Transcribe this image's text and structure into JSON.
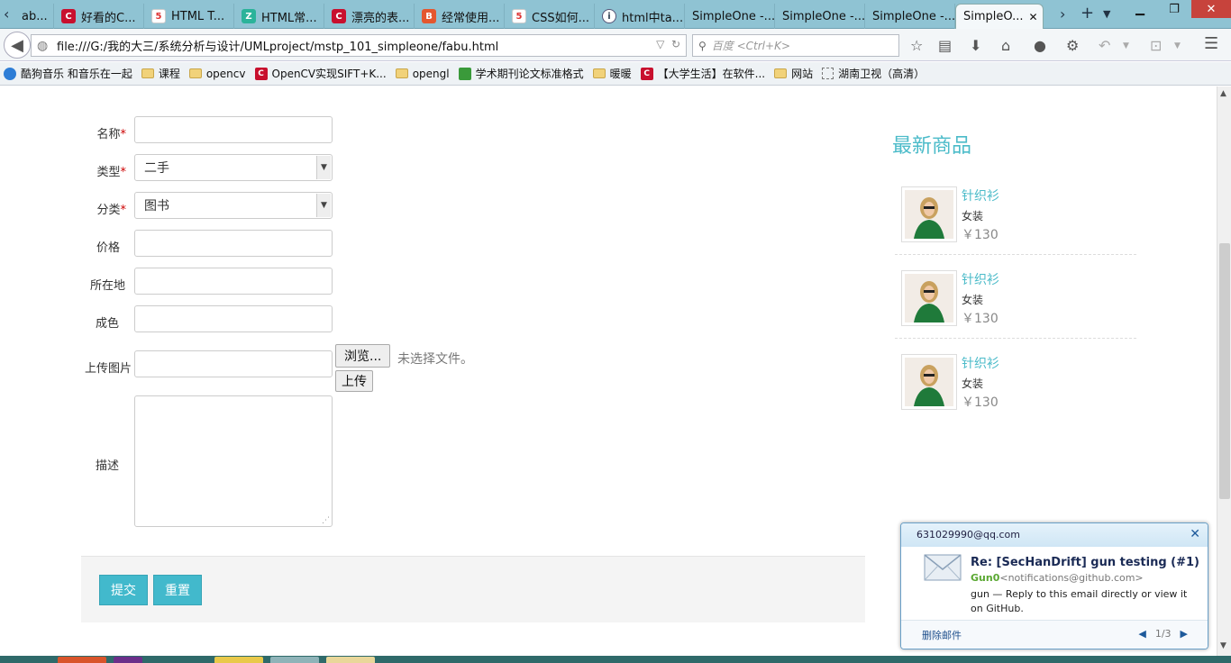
{
  "tabs": [
    {
      "label": "ab...",
      "icon": "none"
    },
    {
      "label": "好看的C...",
      "icon": "c"
    },
    {
      "label": "HTML T...",
      "icon": "h5"
    },
    {
      "label": "HTML常...",
      "icon": "z"
    },
    {
      "label": "漂亮的表...",
      "icon": "c"
    },
    {
      "label": "经常使用...",
      "icon": "b"
    },
    {
      "label": "CSS如何...",
      "icon": "h5"
    },
    {
      "label": "html中ta...",
      "icon": "i"
    },
    {
      "label": "SimpleOne -...",
      "icon": "none"
    },
    {
      "label": "SimpleOne -...",
      "icon": "none"
    },
    {
      "label": "SimpleOne -...",
      "icon": "none"
    },
    {
      "label": "SimpleO...",
      "icon": "none"
    }
  ],
  "toolbar": {
    "url": "file:///G:/我的大三/系统分析与设计/UMLproject/mstp_101_simpleone/fabu.html",
    "search_placeholder": "百度 <Ctrl+K>"
  },
  "bookmarks": [
    {
      "label": "酷狗音乐 和音乐在一起",
      "icon": "kugou"
    },
    {
      "label": "课程",
      "icon": "folder"
    },
    {
      "label": "opencv",
      "icon": "folder"
    },
    {
      "label": "OpenCV实现SIFT+K...",
      "icon": "csdn"
    },
    {
      "label": "opengl",
      "icon": "folder"
    },
    {
      "label": "学术期刊论文标准格式",
      "icon": "green"
    },
    {
      "label": "暖暖",
      "icon": "folder"
    },
    {
      "label": "【大学生活】在软件...",
      "icon": "csdn"
    },
    {
      "label": "网站",
      "icon": "folder"
    },
    {
      "label": "湖南卫视（高清）",
      "icon": "dashed"
    }
  ],
  "form": {
    "name_label": "名称",
    "type_label": "类型",
    "category_label": "分类",
    "price_label": "价格",
    "location_label": "所在地",
    "condition_label": "成色",
    "upload_label": "上传图片",
    "desc_label": "描述",
    "required_mark": "*",
    "type_value": "二手",
    "category_value": "图书",
    "browse_label": "浏览...",
    "no_file_text": "未选择文件。",
    "upload_button": "上传",
    "submit_button": "提交",
    "reset_button": "重置"
  },
  "sidebar": {
    "title": "最新商品",
    "products": [
      {
        "name": "针织衫",
        "category": "女装",
        "price": "￥130"
      },
      {
        "name": "针织衫",
        "category": "女装",
        "price": "￥130"
      },
      {
        "name": "针织衫",
        "category": "女装",
        "price": "￥130"
      }
    ]
  },
  "notification": {
    "account": "631029990@qq.com",
    "subject": "Re: [SecHanDrift] gun testing (#1)",
    "sender_name": "Gun0",
    "sender_email": "<notifications@github.com>",
    "body": "gun — Reply to this email directly or view it on GitHub.",
    "delete_label": "删除邮件",
    "page": "1/3"
  },
  "colors": {
    "accent": "#42b9cc",
    "tab_strip": "#8fc3d3",
    "required": "#cc0000"
  }
}
